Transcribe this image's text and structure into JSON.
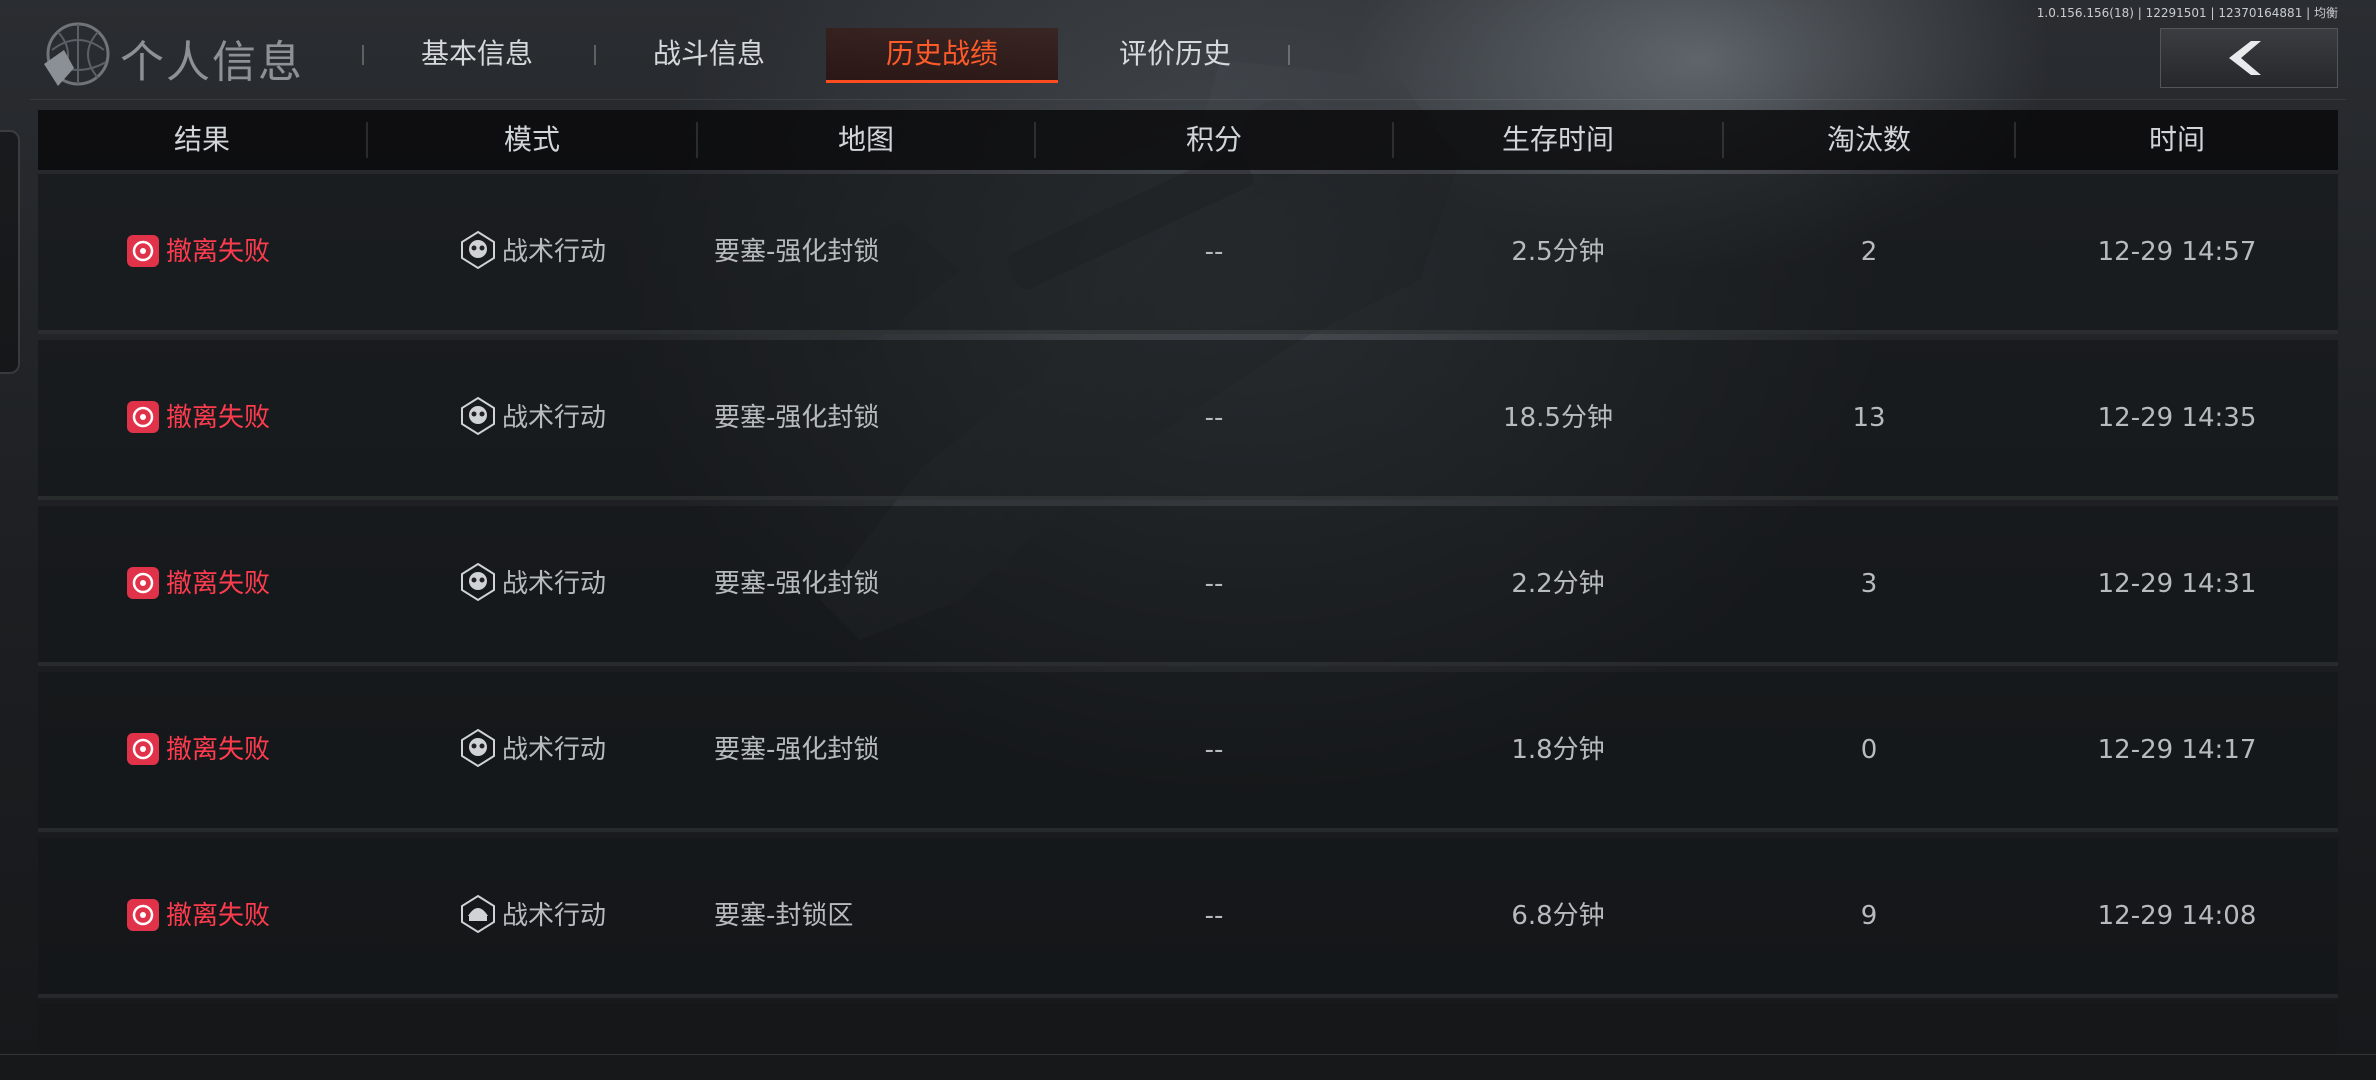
{
  "header": {
    "title": "个人信息",
    "version": "1.0.156.156(18) | 12291501 | 12370164881 | 均衡",
    "tabs": [
      {
        "label": "基本信息"
      },
      {
        "label": "战斗信息"
      },
      {
        "label": "历史战绩",
        "active": true
      },
      {
        "label": "评价历史"
      }
    ]
  },
  "table": {
    "columns": [
      "结果",
      "模式",
      "地图",
      "积分",
      "生存时间",
      "淘汰数",
      "时间"
    ],
    "rows": [
      {
        "result": "撤离失败",
        "mode": "战术行动",
        "map": "要塞-强化封锁",
        "score": "--",
        "survival": "2.5分钟",
        "kills": "2",
        "time": "12-29 14:57"
      },
      {
        "result": "撤离失败",
        "mode": "战术行动",
        "map": "要塞-强化封锁",
        "score": "--",
        "survival": "18.5分钟",
        "kills": "13",
        "time": "12-29 14:35"
      },
      {
        "result": "撤离失败",
        "mode": "战术行动",
        "map": "要塞-强化封锁",
        "score": "--",
        "survival": "2.2分钟",
        "kills": "3",
        "time": "12-29 14:31"
      },
      {
        "result": "撤离失败",
        "mode": "战术行动",
        "map": "要塞-强化封锁",
        "score": "--",
        "survival": "1.8分钟",
        "kills": "0",
        "time": "12-29 14:17"
      },
      {
        "result": "撤离失败",
        "mode": "战术行动",
        "map": "要塞-封锁区",
        "score": "--",
        "survival": "6.8分钟",
        "kills": "9",
        "time": "12-29 14:08"
      }
    ]
  },
  "colors": {
    "accent": "#ff5a2a",
    "fail": "#ff3b4e"
  },
  "icons": {
    "back": "chevron-left-icon",
    "result": "target-icon",
    "mode": "gasmask-icon"
  }
}
